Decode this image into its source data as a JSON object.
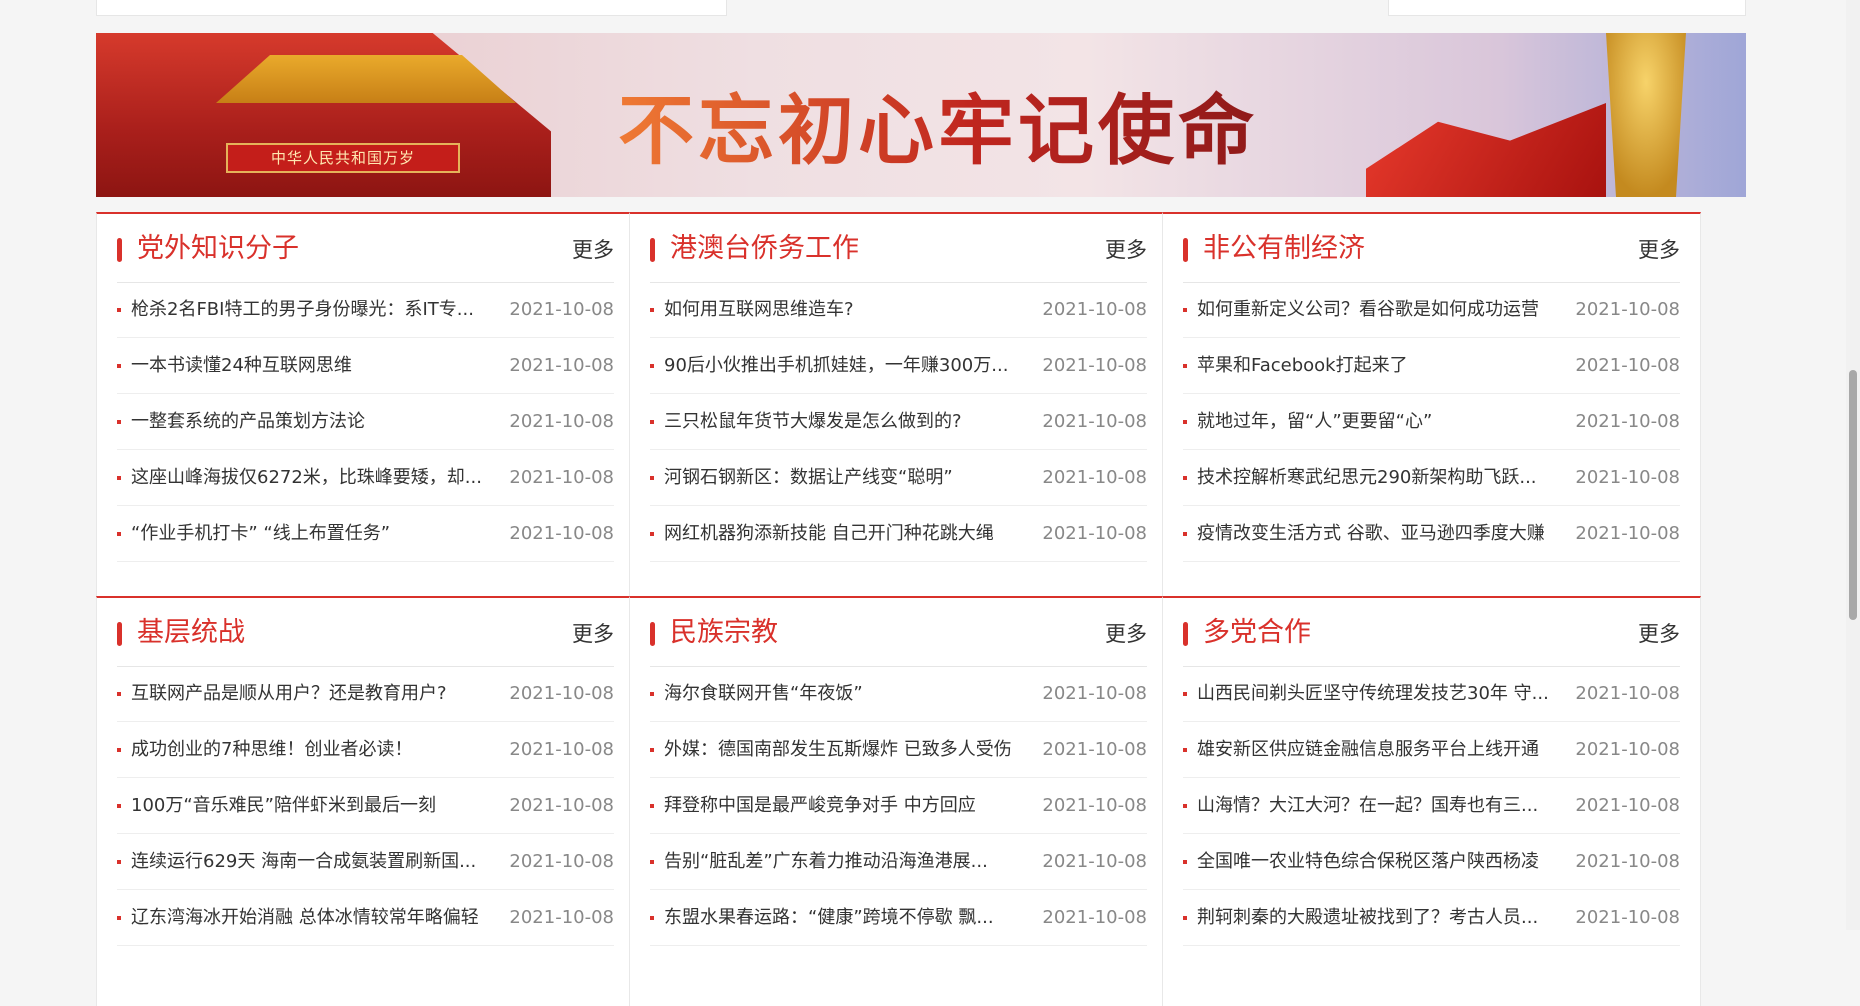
{
  "banner": {
    "slogan": "不忘初心牢记使命",
    "plaque": "中华人民共和国万岁"
  },
  "colors": {
    "accent": "#d9312b",
    "date": "#888888"
  },
  "sections": [
    {
      "title": "党外知识分子",
      "more": "更多",
      "items": [
        {
          "title": "枪杀2名FBI特工的男子身份曝光：系IT专...",
          "date": "2021-10-08"
        },
        {
          "title": "一本书读懂24种互联网思维",
          "date": "2021-10-08"
        },
        {
          "title": "一整套系统的产品策划方法论",
          "date": "2021-10-08"
        },
        {
          "title": "这座山峰海拔仅6272米，比珠峰要矮，却...",
          "date": "2021-10-08"
        },
        {
          "title": "“作业手机打卡” “线上布置任务”",
          "date": "2021-10-08"
        }
      ]
    },
    {
      "title": "港澳台侨务工作",
      "more": "更多",
      "items": [
        {
          "title": "如何用互联网思维造车?",
          "date": "2021-10-08"
        },
        {
          "title": "90后小伙推出手机抓娃娃，一年赚300万...",
          "date": "2021-10-08"
        },
        {
          "title": "三只松鼠年货节大爆发是怎么做到的?",
          "date": "2021-10-08"
        },
        {
          "title": "河钢石钢新区：数据让产线变“聪明”",
          "date": "2021-10-08"
        },
        {
          "title": "网红机器狗添新技能 自己开门种花跳大绳",
          "date": "2021-10-08"
        }
      ]
    },
    {
      "title": "非公有制经济",
      "more": "更多",
      "items": [
        {
          "title": "如何重新定义公司？看谷歌是如何成功运营",
          "date": "2021-10-08"
        },
        {
          "title": "苹果和Facebook打起来了",
          "date": "2021-10-08"
        },
        {
          "title": "就地过年，留“人”更要留“心”",
          "date": "2021-10-08"
        },
        {
          "title": "技术控解析寒武纪思元290新架构助飞跃...",
          "date": "2021-10-08"
        },
        {
          "title": "疫情改变生活方式 谷歌、亚马逊四季度大赚",
          "date": "2021-10-08"
        }
      ]
    },
    {
      "title": "基层统战",
      "more": "更多",
      "items": [
        {
          "title": "互联网产品是顺从用户？还是教育用户?",
          "date": "2021-10-08"
        },
        {
          "title": "成功创业的7种思维！创业者必读！",
          "date": "2021-10-08"
        },
        {
          "title": "100万“音乐难民”陪伴虾米到最后一刻",
          "date": "2021-10-08"
        },
        {
          "title": "连续运行629天 海南一合成氨装置刷新国...",
          "date": "2021-10-08"
        },
        {
          "title": "辽东湾海冰开始消融 总体冰情较常年略偏轻",
          "date": "2021-10-08"
        }
      ]
    },
    {
      "title": "民族宗教",
      "more": "更多",
      "items": [
        {
          "title": "海尔食联网开售“年夜饭”",
          "date": "2021-10-08"
        },
        {
          "title": "外媒：德国南部发生瓦斯爆炸 已致多人受伤",
          "date": "2021-10-08"
        },
        {
          "title": "拜登称中国是最严峻竞争对手 中方回应",
          "date": "2021-10-08"
        },
        {
          "title": "告别“脏乱差”广东着力推动沿海渔港展...",
          "date": "2021-10-08"
        },
        {
          "title": "东盟水果春运路：“健康”跨境不停歇 飘...",
          "date": "2021-10-08"
        }
      ]
    },
    {
      "title": "多党合作",
      "more": "更多",
      "items": [
        {
          "title": "山西民间剃头匠坚守传统理发技艺30年 守...",
          "date": "2021-10-08"
        },
        {
          "title": "雄安新区供应链金融信息服务平台上线开通",
          "date": "2021-10-08"
        },
        {
          "title": "山海情？大江大河？在一起？国寿也有三...",
          "date": "2021-10-08"
        },
        {
          "title": "全国唯一农业特色综合保税区落户陕西杨凌",
          "date": "2021-10-08"
        },
        {
          "title": "荆轲刺秦的大殿遗址被找到了？考古人员...",
          "date": "2021-10-08"
        }
      ]
    }
  ]
}
